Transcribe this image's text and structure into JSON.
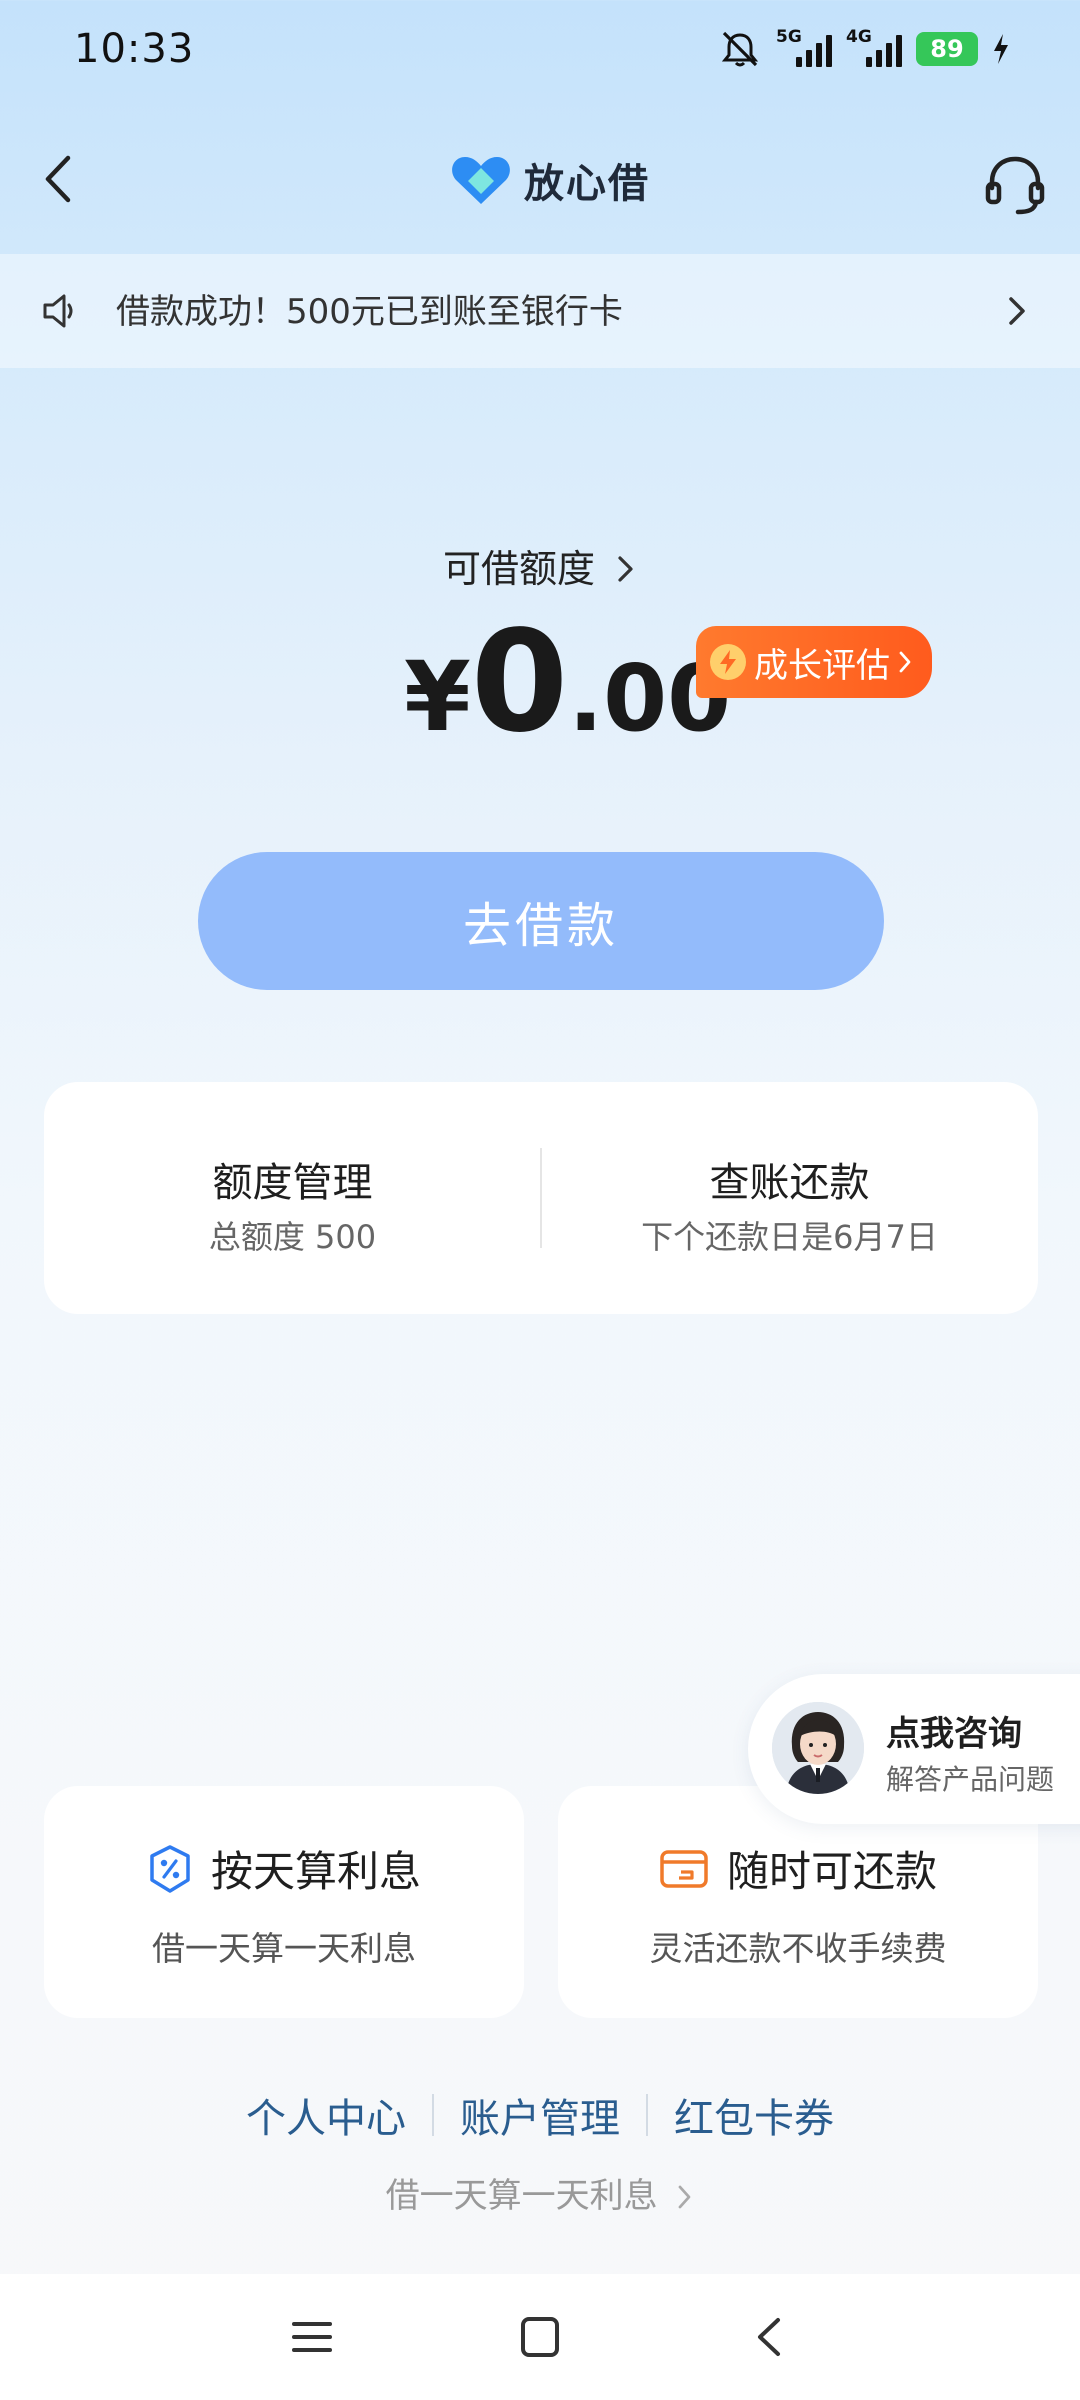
{
  "status_bar": {
    "time": "10:33",
    "network_1": "5G",
    "network_2": "4G",
    "battery": "89",
    "icons": [
      "mute-icon",
      "signal-icon",
      "battery-icon",
      "charging-icon"
    ]
  },
  "header": {
    "brand": "放心借",
    "icons": [
      "back-arrow-icon",
      "brand-logo-icon",
      "headset-icon"
    ]
  },
  "notice": {
    "text": "借款成功！500元已到账至银行卡",
    "icons": [
      "speaker-icon",
      "chevron-right-icon"
    ]
  },
  "credit": {
    "label": "可借额度",
    "currency": "¥",
    "integer": "0",
    "decimal": ".00",
    "growth_badge": "成长评估"
  },
  "borrow_button": "去借款",
  "manage_card": {
    "left_title": "额度管理",
    "left_sub": "总额度 500",
    "right_title": "查账还款",
    "right_sub": "下个还款日是6月7日"
  },
  "consult": {
    "title": "点我咨询",
    "subtitle": "解答产品问题"
  },
  "features": [
    {
      "title": "按天算利息",
      "subtitle": "借一天算一天利息",
      "icon": "percent-shield-icon"
    },
    {
      "title": "随时可还款",
      "subtitle": "灵活还款不收手续费",
      "icon": "wallet-icon"
    }
  ],
  "links": [
    "个人中心",
    "账户管理",
    "红包卡券"
  ],
  "tagline": "借一天算一天利息",
  "colors": {
    "primary_button": "#93bbfb",
    "growth_badge": "#ff6a24",
    "link": "#2a5d8f",
    "battery": "#35c759"
  }
}
